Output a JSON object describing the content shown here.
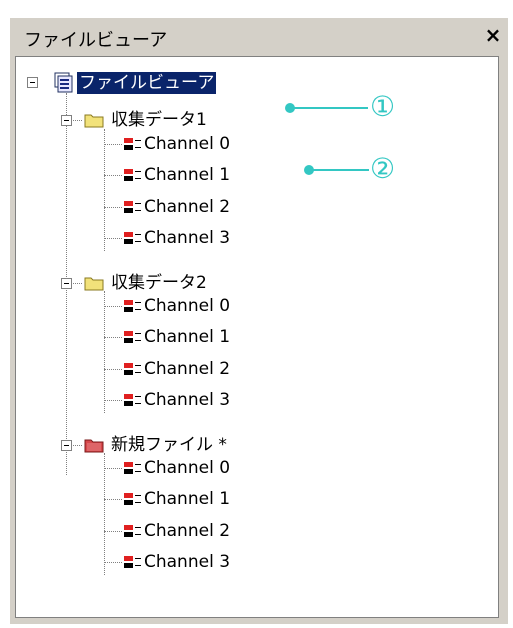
{
  "window": {
    "title": "ファイルビューア",
    "close_label": "×"
  },
  "tree": {
    "root_label": "ファイルビューア",
    "groups": [
      {
        "label": "収集データ1",
        "folder_color": "#f2e27a",
        "channels": [
          "Channel 0",
          "Channel 1",
          "Channel 2",
          "Channel 3"
        ]
      },
      {
        "label": "収集データ2",
        "folder_color": "#f2e27a",
        "channels": [
          "Channel 0",
          "Channel 1",
          "Channel 2",
          "Channel 3"
        ]
      },
      {
        "label": "新規ファイル *",
        "folder_color": "#d6474a",
        "channels": [
          "Channel 0",
          "Channel 1",
          "Channel 2",
          "Channel 3"
        ]
      }
    ]
  },
  "callouts": [
    "①",
    "②"
  ],
  "colors": {
    "selection": "#0a246a",
    "callout": "#33c7c3",
    "channel_icon_top": "#e02020",
    "channel_icon_bottom": "#000000"
  }
}
